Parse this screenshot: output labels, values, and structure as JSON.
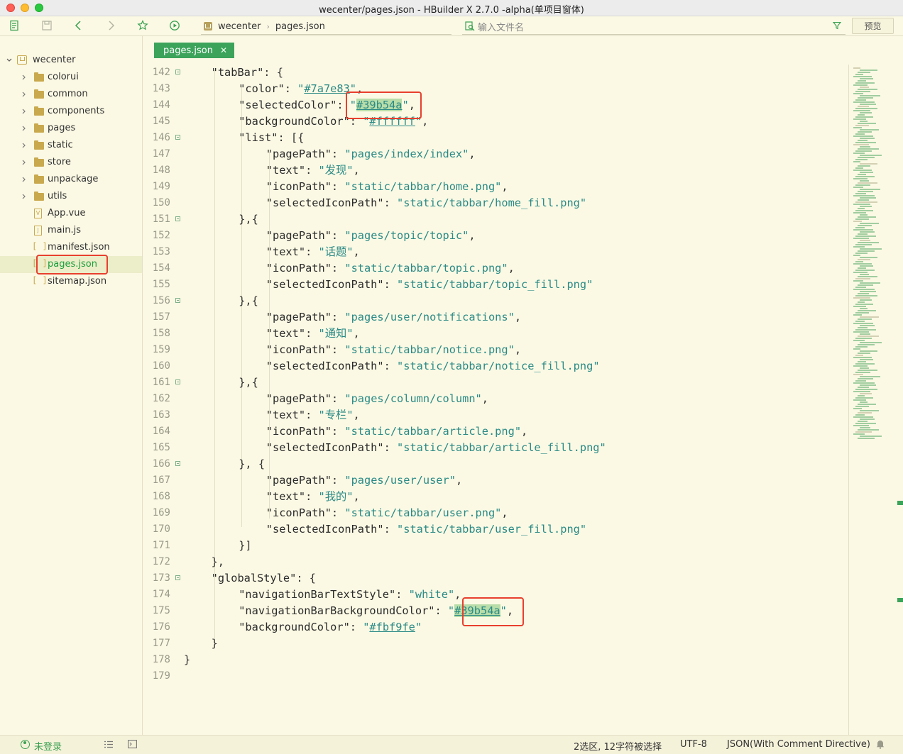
{
  "window": {
    "title": "wecenter/pages.json - HBuilder X 2.7.0 -alpha(单项目窗体)"
  },
  "toolbar": {
    "breadcrumb": [
      "wecenter",
      "pages.json"
    ],
    "search_placeholder": "输入文件名",
    "preview_label": "预览",
    "accent": "#3aa052"
  },
  "sidebar": {
    "project": "wecenter",
    "items": [
      {
        "label": "colorui",
        "type": "folder"
      },
      {
        "label": "common",
        "type": "folder"
      },
      {
        "label": "components",
        "type": "folder"
      },
      {
        "label": "pages",
        "type": "folder"
      },
      {
        "label": "static",
        "type": "folder"
      },
      {
        "label": "store",
        "type": "folder"
      },
      {
        "label": "unpackage",
        "type": "folder"
      },
      {
        "label": "utils",
        "type": "folder"
      },
      {
        "label": "App.vue",
        "type": "vue"
      },
      {
        "label": "main.js",
        "type": "js"
      },
      {
        "label": "manifest.json",
        "type": "json"
      },
      {
        "label": "pages.json",
        "type": "json",
        "selected": true
      },
      {
        "label": "sitemap.json",
        "type": "json"
      }
    ]
  },
  "editor": {
    "tab_label": "pages.json",
    "lines": [
      {
        "n": "142",
        "fold": true,
        "indent": 1,
        "key": "tabBar",
        "rest": ": {"
      },
      {
        "n": "143",
        "fold": false,
        "indent": 2,
        "key": "color",
        "val": "#7a7e83",
        "color": true,
        "rest": ","
      },
      {
        "n": "144",
        "fold": false,
        "indent": 2,
        "key": "selectedColor",
        "val": "#39b54a",
        "color": true,
        "sel": true,
        "rest": ","
      },
      {
        "n": "145",
        "fold": false,
        "indent": 2,
        "key": "backgroundColor",
        "val": "#ffffff",
        "color": true,
        "rest": ","
      },
      {
        "n": "146",
        "fold": true,
        "indent": 2,
        "key": "list",
        "rest": ": [{"
      },
      {
        "n": "147",
        "fold": false,
        "indent": 3,
        "key": "pagePath",
        "val": "pages/index/index",
        "rest": ","
      },
      {
        "n": "148",
        "fold": false,
        "indent": 3,
        "key": "text",
        "val": "发现",
        "rest": ","
      },
      {
        "n": "149",
        "fold": false,
        "indent": 3,
        "key": "iconPath",
        "val": "static/tabbar/home.png",
        "rest": ","
      },
      {
        "n": "150",
        "fold": false,
        "indent": 3,
        "key": "selectedIconPath",
        "val": "static/tabbar/home_fill.png",
        "rest": ""
      },
      {
        "n": "151",
        "fold": true,
        "indent": 2,
        "plain": "},{"
      },
      {
        "n": "152",
        "fold": false,
        "indent": 3,
        "key": "pagePath",
        "val": "pages/topic/topic",
        "rest": ","
      },
      {
        "n": "153",
        "fold": false,
        "indent": 3,
        "key": "text",
        "val": "话题",
        "rest": ","
      },
      {
        "n": "154",
        "fold": false,
        "indent": 3,
        "key": "iconPath",
        "val": "static/tabbar/topic.png",
        "rest": ","
      },
      {
        "n": "155",
        "fold": false,
        "indent": 3,
        "key": "selectedIconPath",
        "val": "static/tabbar/topic_fill.png",
        "rest": ""
      },
      {
        "n": "156",
        "fold": true,
        "indent": 2,
        "plain": "},{"
      },
      {
        "n": "157",
        "fold": false,
        "indent": 3,
        "key": "pagePath",
        "val": "pages/user/notifications",
        "rest": ","
      },
      {
        "n": "158",
        "fold": false,
        "indent": 3,
        "key": "text",
        "val": "通知",
        "rest": ","
      },
      {
        "n": "159",
        "fold": false,
        "indent": 3,
        "key": "iconPath",
        "val": "static/tabbar/notice.png",
        "rest": ","
      },
      {
        "n": "160",
        "fold": false,
        "indent": 3,
        "key": "selectedIconPath",
        "val": "static/tabbar/notice_fill.png",
        "rest": ""
      },
      {
        "n": "161",
        "fold": true,
        "indent": 2,
        "plain": "},{"
      },
      {
        "n": "162",
        "fold": false,
        "indent": 3,
        "key": "pagePath",
        "val": "pages/column/column",
        "rest": ","
      },
      {
        "n": "163",
        "fold": false,
        "indent": 3,
        "key": "text",
        "val": "专栏",
        "rest": ","
      },
      {
        "n": "164",
        "fold": false,
        "indent": 3,
        "key": "iconPath",
        "val": "static/tabbar/article.png",
        "rest": ","
      },
      {
        "n": "165",
        "fold": false,
        "indent": 3,
        "key": "selectedIconPath",
        "val": "static/tabbar/article_fill.png",
        "rest": ""
      },
      {
        "n": "166",
        "fold": true,
        "indent": 2,
        "plain": "}, {"
      },
      {
        "n": "167",
        "fold": false,
        "indent": 3,
        "key": "pagePath",
        "val": "pages/user/user",
        "rest": ","
      },
      {
        "n": "168",
        "fold": false,
        "indent": 3,
        "key": "text",
        "val": "我的",
        "rest": ","
      },
      {
        "n": "169",
        "fold": false,
        "indent": 3,
        "key": "iconPath",
        "val": "static/tabbar/user.png",
        "rest": ","
      },
      {
        "n": "170",
        "fold": false,
        "indent": 3,
        "key": "selectedIconPath",
        "val": "static/tabbar/user_fill.png",
        "rest": ""
      },
      {
        "n": "171",
        "fold": false,
        "indent": 2,
        "plain": "}]"
      },
      {
        "n": "172",
        "fold": false,
        "indent": 1,
        "plain": "},"
      },
      {
        "n": "173",
        "fold": true,
        "indent": 1,
        "key": "globalStyle",
        "rest": ": {"
      },
      {
        "n": "174",
        "fold": false,
        "indent": 2,
        "key": "navigationBarTextStyle",
        "val": "white",
        "rest": ","
      },
      {
        "n": "175",
        "fold": false,
        "indent": 2,
        "key": "navigationBarBackgroundColor",
        "val": "#39b54a",
        "color": true,
        "sel": true,
        "rest": ","
      },
      {
        "n": "176",
        "fold": false,
        "indent": 2,
        "key": "backgroundColor",
        "val": "#fbf9fe",
        "color": true,
        "rest": ""
      },
      {
        "n": "177",
        "fold": false,
        "indent": 1,
        "plain": "}"
      },
      {
        "n": "178",
        "fold": false,
        "indent": 0,
        "plain": "}"
      },
      {
        "n": "179",
        "fold": false,
        "indent": 0,
        "plain": ""
      }
    ]
  },
  "statusbar": {
    "login": "未登录",
    "selection": "2选区, 12字符被选择",
    "encoding": "UTF-8",
    "language": "JSON(With Comment Directive)"
  }
}
